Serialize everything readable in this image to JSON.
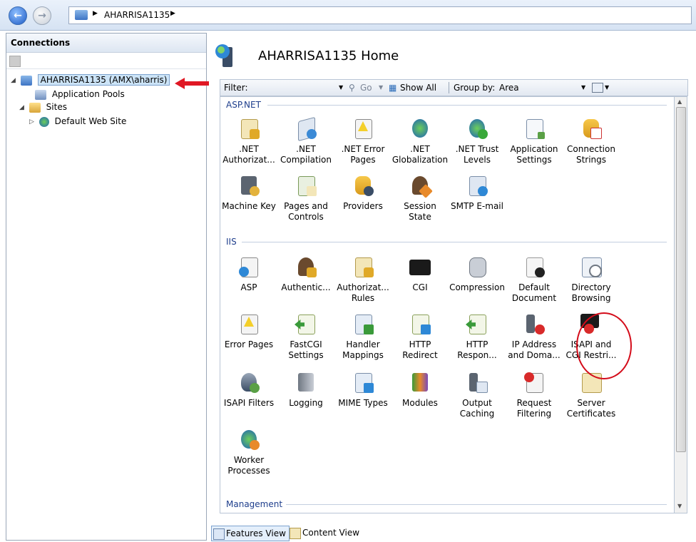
{
  "nav": {
    "address_segments": [
      "AHARRISA1135"
    ]
  },
  "connections": {
    "header": "Connections",
    "tree": [
      {
        "label": "AHARRISA1135 (AMX\\aharris)",
        "icon": "server-icon",
        "selected": true
      },
      {
        "label": "Application Pools",
        "icon": "app-pool-icon"
      },
      {
        "label": "Sites",
        "icon": "sites-folder-icon"
      },
      {
        "label": "Default Web Site",
        "icon": "globe-icon"
      }
    ]
  },
  "main": {
    "title": "AHARRISA1135 Home",
    "filter": {
      "label": "Filter:",
      "go": "Go",
      "show_all": "Show All",
      "group_by_label": "Group by:",
      "group_by_value": "Area"
    },
    "groups": [
      {
        "name": "ASP.NET",
        "features": [
          ".NET Authorizat...",
          ".NET Compilation",
          ".NET Error Pages",
          ".NET Globalization",
          ".NET Trust Levels",
          "Application Settings",
          "Connection Strings",
          "Machine Key",
          "Pages and Controls",
          "Providers",
          "Session State",
          "SMTP E-mail"
        ]
      },
      {
        "name": "IIS",
        "features": [
          "ASP",
          "Authentic...",
          "Authorizat... Rules",
          "CGI",
          "Compression",
          "Default Document",
          "Directory Browsing",
          "Error Pages",
          "FastCGI Settings",
          "Handler Mappings",
          "HTTP Redirect",
          "HTTP Respon...",
          "IP Address and Doma...",
          "ISAPI and CGI Restri...",
          "ISAPI Filters",
          "Logging",
          "MIME Types",
          "Modules",
          "Output Caching",
          "Request Filtering",
          "Server Certificates",
          "Worker Processes"
        ]
      },
      {
        "name": "Management",
        "features": []
      }
    ]
  },
  "bottom": {
    "features_view": "Features View",
    "content_view": "Content View"
  },
  "colors": {
    "annotation": "#d40c1a",
    "group_header": "#1e3e8c",
    "selection": "#cce4f7"
  }
}
